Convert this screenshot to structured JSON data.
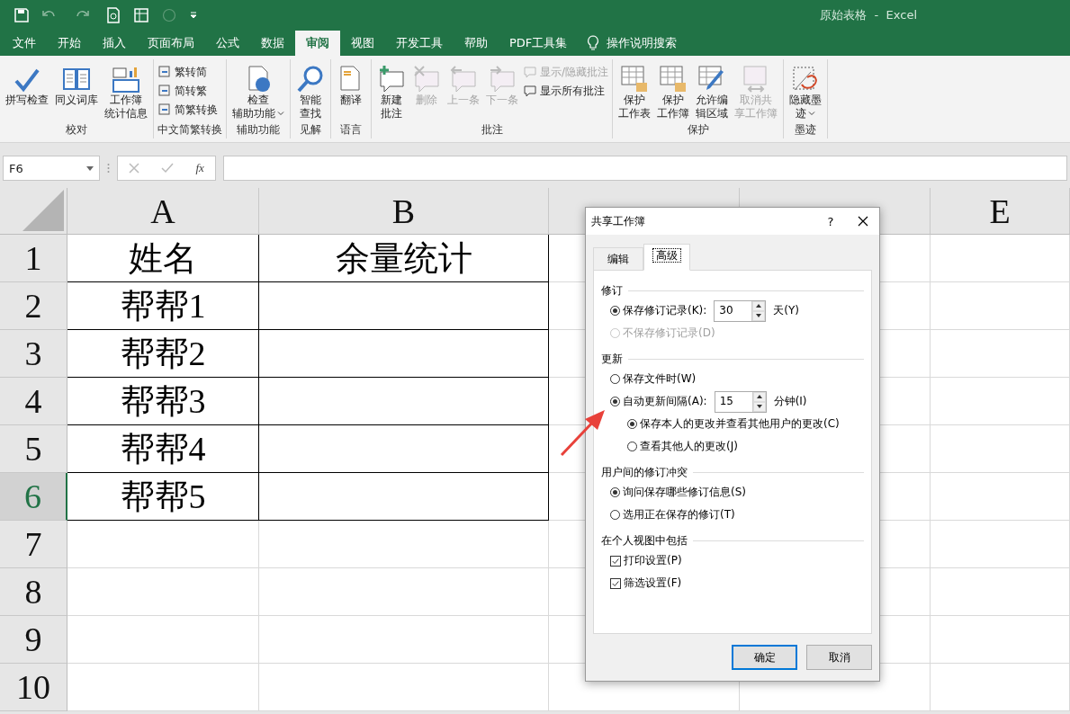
{
  "title_bar": {
    "title": "原始表格  -  Excel"
  },
  "ribbon_tabs": [
    {
      "label": "文件",
      "selected": false
    },
    {
      "label": "开始",
      "selected": false
    },
    {
      "label": "插入",
      "selected": false
    },
    {
      "label": "页面布局",
      "selected": false
    },
    {
      "label": "公式",
      "selected": false
    },
    {
      "label": "数据",
      "selected": false
    },
    {
      "label": "审阅",
      "selected": true
    },
    {
      "label": "视图",
      "selected": false
    },
    {
      "label": "开发工具",
      "selected": false
    },
    {
      "label": "帮助",
      "selected": false
    },
    {
      "label": "PDF工具集",
      "selected": false
    }
  ],
  "tell_me": "操作说明搜索",
  "ribbon_groups": [
    {
      "label": "校对",
      "buttons": [
        {
          "kind": "large",
          "lines": [
            "拼写检查"
          ],
          "disabled": false
        },
        {
          "kind": "large",
          "lines": [
            "同义词库"
          ],
          "disabled": false
        },
        {
          "kind": "large",
          "lines": [
            "工作簿",
            "统计信息"
          ],
          "disabled": false
        }
      ]
    },
    {
      "label": "中文简繁转换",
      "buttons": [
        {
          "kind": "small",
          "lines": [
            "繁转简"
          ],
          "disabled": false
        },
        {
          "kind": "small",
          "lines": [
            "简转繁"
          ],
          "disabled": false
        },
        {
          "kind": "small",
          "lines": [
            "简繁转换"
          ],
          "disabled": false
        }
      ]
    },
    {
      "label": "辅助功能",
      "buttons": [
        {
          "kind": "large",
          "lines": [
            "检查",
            "辅助功能"
          ],
          "disabled": false,
          "dropdown": true
        }
      ]
    },
    {
      "label": "见解",
      "buttons": [
        {
          "kind": "large",
          "lines": [
            "智能",
            "查找"
          ],
          "disabled": false
        }
      ]
    },
    {
      "label": "语言",
      "buttons": [
        {
          "kind": "large",
          "lines": [
            "翻译"
          ],
          "disabled": false
        }
      ]
    },
    {
      "label": "批注",
      "buttons": [
        {
          "kind": "large",
          "lines": [
            "新建",
            "批注"
          ],
          "disabled": false
        },
        {
          "kind": "large",
          "lines": [
            "删除"
          ],
          "disabled": true
        },
        {
          "kind": "large",
          "lines": [
            "上一条"
          ],
          "disabled": true
        },
        {
          "kind": "large",
          "lines": [
            "下一条"
          ],
          "disabled": true
        },
        {
          "kind": "small",
          "lines": [
            "显示/隐藏批注"
          ],
          "disabled": true
        },
        {
          "kind": "small",
          "lines": [
            "显示所有批注"
          ],
          "disabled": false
        }
      ]
    },
    {
      "label": "保护",
      "buttons": [
        {
          "kind": "large",
          "lines": [
            "保护",
            "工作表"
          ],
          "disabled": false
        },
        {
          "kind": "large",
          "lines": [
            "保护",
            "工作簿"
          ],
          "disabled": false
        },
        {
          "kind": "large",
          "lines": [
            "允许编",
            "辑区域"
          ],
          "disabled": false
        },
        {
          "kind": "large",
          "lines": [
            "取消共",
            "享工作簿"
          ],
          "disabled": true
        }
      ]
    },
    {
      "label": "墨迹",
      "buttons": [
        {
          "kind": "large",
          "lines": [
            "隐藏墨",
            "迹"
          ],
          "disabled": false,
          "dropdown": true
        }
      ]
    }
  ],
  "name_box": "F6",
  "function_label": "fx",
  "sheet": {
    "columns": [
      "A",
      "B",
      "",
      "",
      " E"
    ],
    "rows": [
      {
        "header": "1",
        "selected": false,
        "boxed": true,
        "cells": [
          "姓名",
          "余量统计"
        ]
      },
      {
        "header": "2",
        "selected": false,
        "boxed": true,
        "cells": [
          "帮帮1",
          ""
        ]
      },
      {
        "header": "3",
        "selected": false,
        "boxed": true,
        "cells": [
          "帮帮2",
          ""
        ]
      },
      {
        "header": "4",
        "selected": false,
        "boxed": true,
        "cells": [
          "帮帮3",
          ""
        ]
      },
      {
        "header": "5",
        "selected": false,
        "boxed": true,
        "cells": [
          "帮帮4",
          ""
        ]
      },
      {
        "header": "6",
        "selected": true,
        "boxed": true,
        "cells": [
          "帮帮5",
          ""
        ]
      },
      {
        "header": "7",
        "selected": false,
        "boxed": false,
        "cells": []
      },
      {
        "header": "8",
        "selected": false,
        "boxed": false,
        "cells": []
      },
      {
        "header": "9",
        "selected": false,
        "boxed": false,
        "cells": []
      },
      {
        "header": "10",
        "selected": false,
        "boxed": false,
        "cells": []
      }
    ]
  },
  "dialog": {
    "title": "共享工作簿",
    "help": "?",
    "tabs": [
      {
        "label": "编辑",
        "selected": false
      },
      {
        "label": "高级",
        "selected": true
      }
    ],
    "sections": [
      {
        "title": "修订",
        "items": [
          {
            "kind": "radio",
            "label": "保存修订记录(K):",
            "selected": true,
            "disabled": false,
            "spin": {
              "value": "30",
              "unit": "天(Y)"
            }
          },
          {
            "kind": "radio",
            "label": "不保存修订记录(D)",
            "selected": false,
            "disabled": true
          }
        ]
      },
      {
        "title": "更新",
        "items": [
          {
            "kind": "radio",
            "label": "保存文件时(W)",
            "selected": false,
            "disabled": false
          },
          {
            "kind": "radio",
            "label": "自动更新间隔(A):",
            "selected": true,
            "disabled": false,
            "spin": {
              "value": "15",
              "unit": "分钟(I)"
            },
            "children": [
              {
                "kind": "radio",
                "label": "保存本人的更改并查看其他用户的更改(C)",
                "selected": true,
                "disabled": false
              },
              {
                "kind": "radio",
                "label": "查看其他人的更改(J)",
                "selected": false,
                "disabled": false
              }
            ]
          }
        ]
      },
      {
        "title": "用户间的修订冲突",
        "items": [
          {
            "kind": "radio",
            "label": "询问保存哪些修订信息(S)",
            "selected": true,
            "disabled": false
          },
          {
            "kind": "radio",
            "label": "选用正在保存的修订(T)",
            "selected": false,
            "disabled": false
          }
        ]
      },
      {
        "title": "在个人视图中包括",
        "items": [
          {
            "kind": "checkbox",
            "label": "打印设置(P)",
            "checked": true,
            "disabled": false
          },
          {
            "kind": "checkbox",
            "label": "筛选设置(F)",
            "checked": true,
            "disabled": false
          }
        ]
      }
    ],
    "buttons": [
      {
        "label": "确定",
        "default": true
      },
      {
        "label": "取消",
        "default": false
      }
    ]
  }
}
